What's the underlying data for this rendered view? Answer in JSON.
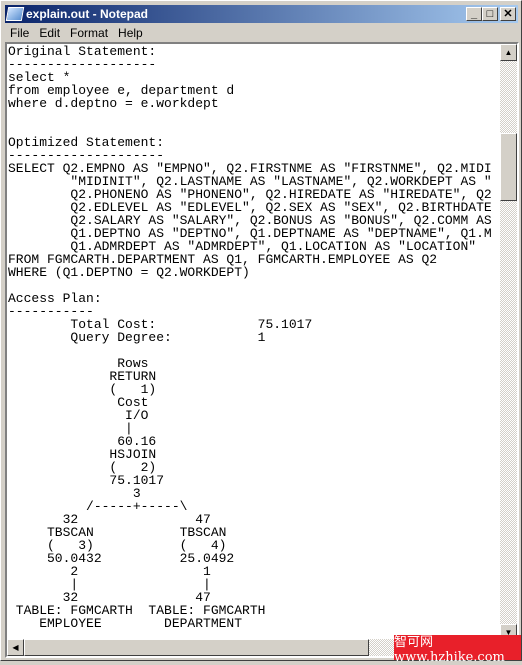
{
  "window": {
    "title": "explain.out - Notepad",
    "controls": {
      "minimize": "_",
      "maximize": "□",
      "close": "✕"
    }
  },
  "menu": [
    {
      "label": "File"
    },
    {
      "label": "Edit"
    },
    {
      "label": "Format"
    },
    {
      "label": "Help"
    }
  ],
  "document": {
    "lines": [
      "Original Statement:",
      "-------------------",
      "select *",
      "from employee e, department d",
      "where d.deptno = e.workdept",
      "",
      "",
      "Optimized Statement:",
      "--------------------",
      "SELECT Q2.EMPNO AS \"EMPNO\", Q2.FIRSTNME AS \"FIRSTNME\", Q2.MIDI",
      "        \"MIDINIT\", Q2.LASTNAME AS \"LASTNAME\", Q2.WORKDEPT AS \"",
      "        Q2.PHONENO AS \"PHONENO\", Q2.HIREDATE AS \"HIREDATE\", Q2",
      "        Q2.EDLEVEL AS \"EDLEVEL\", Q2.SEX AS \"SEX\", Q2.BIRTHDATE",
      "        Q2.SALARY AS \"SALARY\", Q2.BONUS AS \"BONUS\", Q2.COMM AS",
      "        Q1.DEPTNO AS \"DEPTNO\", Q1.DEPTNAME AS \"DEPTNAME\", Q1.M",
      "        Q1.ADMRDEPT AS \"ADMRDEPT\", Q1.LOCATION AS \"LOCATION\"",
      "FROM FGMCARTH.DEPARTMENT AS Q1, FGMCARTH.EMPLOYEE AS Q2",
      "WHERE (Q1.DEPTNO = Q2.WORKDEPT)",
      "",
      "Access Plan:",
      "-----------",
      "        Total Cost:             75.1017",
      "        Query Degree:           1",
      "",
      "              Rows",
      "             RETURN",
      "             (   1)",
      "              Cost",
      "               I/O",
      "               |",
      "              60.16",
      "             HSJOIN",
      "             (   2)",
      "             75.1017",
      "                3",
      "          /-----+-----\\",
      "       32               47",
      "     TBSCAN           TBSCAN",
      "     (   3)           (   4)",
      "     50.0432          25.0492",
      "        2                1",
      "        |                |",
      "       32               47",
      " TABLE: FGMCARTH  TABLE: FGMCARTH",
      "    EMPLOYEE        DEPARTMENT"
    ]
  },
  "watermark": "智可网 www.hzhike.com"
}
